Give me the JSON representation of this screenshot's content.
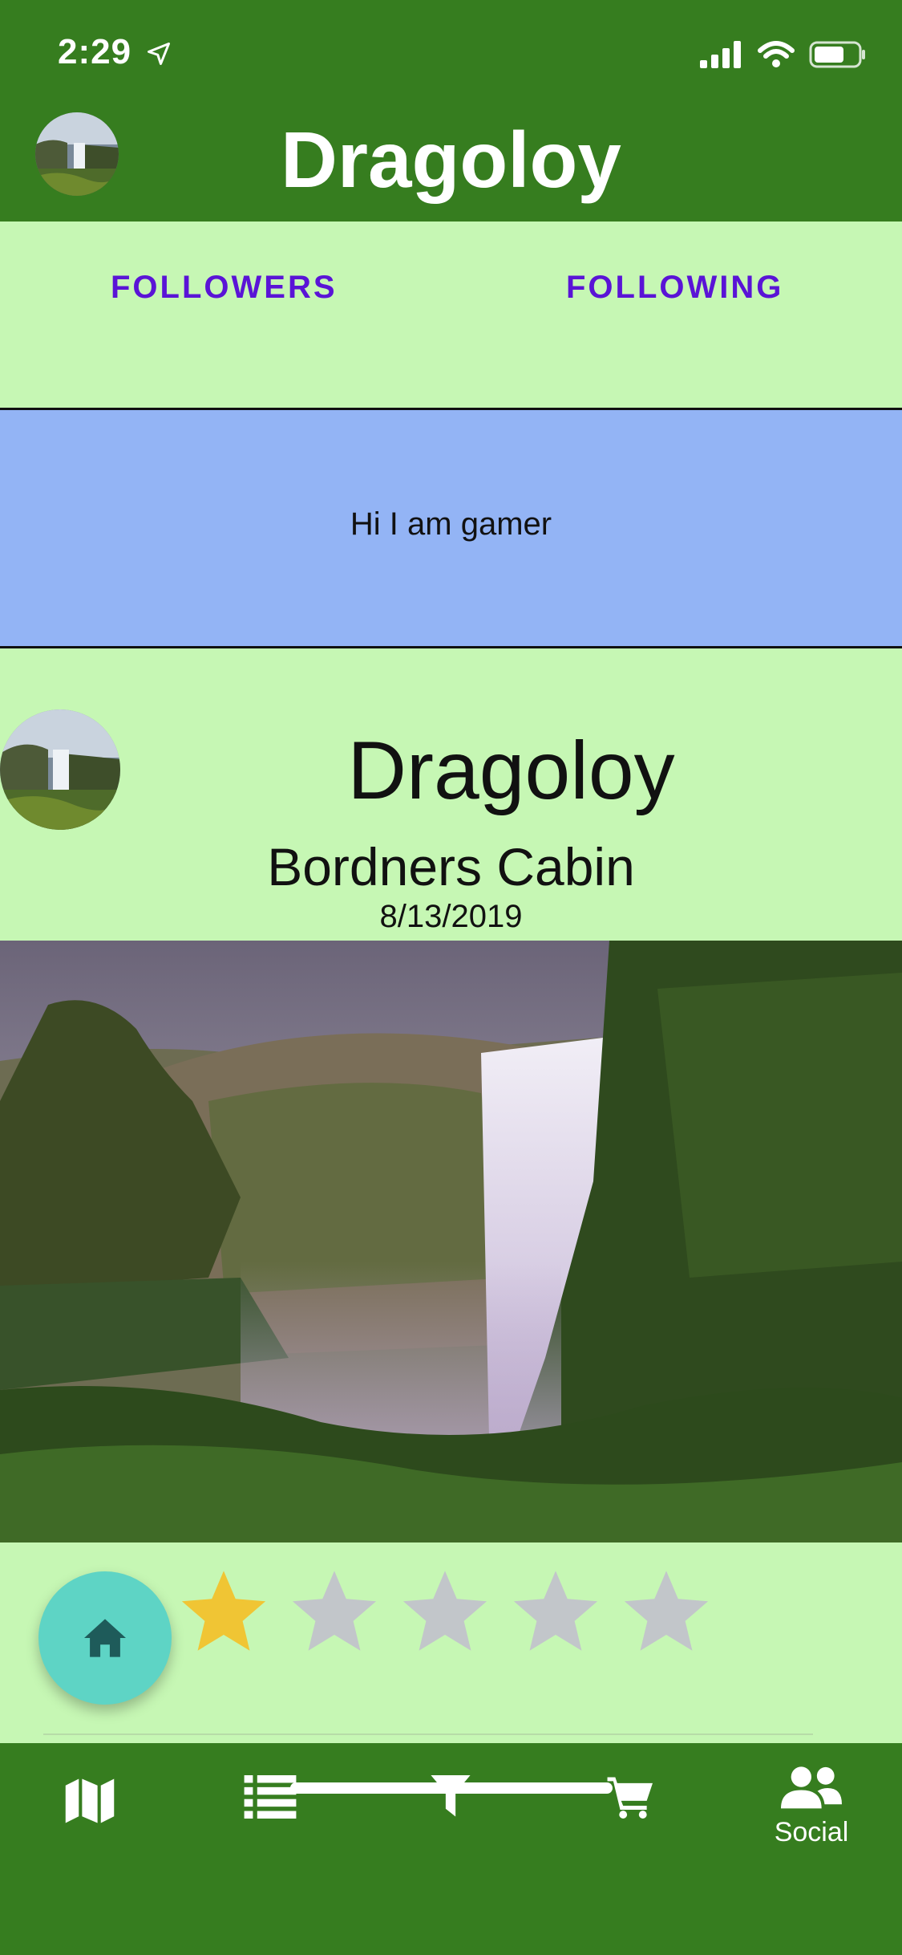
{
  "status": {
    "time": "2:29"
  },
  "header": {
    "title": "Dragoloy"
  },
  "follow": {
    "followers_label": "FOLLOWERS",
    "following_label": "FOLLOWING"
  },
  "bio": {
    "text": "Hi I am gamer"
  },
  "post": {
    "author": "Dragoloy",
    "place": "Bordners Cabin",
    "date": "8/13/2019",
    "rating": 1,
    "rating_max": 5
  },
  "tabbar": {
    "tabs": [
      {
        "icon": "map-icon",
        "label": ""
      },
      {
        "icon": "list-icon",
        "label": ""
      },
      {
        "icon": "filter-icon",
        "label": ""
      },
      {
        "icon": "cart-icon",
        "label": ""
      },
      {
        "icon": "users-icon",
        "label": "Social"
      }
    ]
  },
  "colors": {
    "header_green": "#367d1f",
    "page_green": "#c6f7b4",
    "bio_blue": "#93b4f5",
    "link_purple": "#5a14d6",
    "fab_teal": "#5ed4c5",
    "star_gold": "#f0c534",
    "star_gray": "#c2c6ca"
  }
}
